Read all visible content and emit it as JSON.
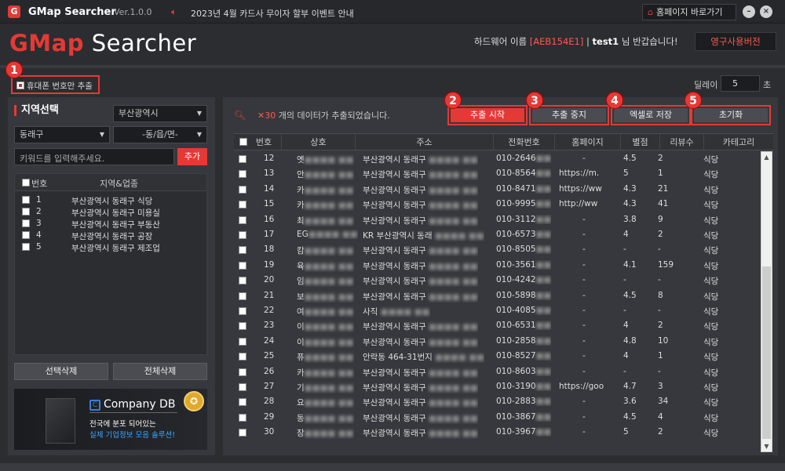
{
  "titlebar": {
    "logo": "G",
    "app_name": "GMap Searcher",
    "version": "Ver.1.0.0",
    "notice": "2023년 4월 카드사 무이자 할부 이벤트 안내",
    "home_button": "홈페이지 바로가기",
    "minimize": "–",
    "close": "×"
  },
  "header": {
    "brand_prefix": "GMap",
    "brand_suffix": " Searcher",
    "hw_prefix": "하드웨어 이름 ",
    "hw_id": "[AEB154E1]",
    "hw_sep": " | ",
    "user": "test1",
    "greeting": " 님 반갑습니다!",
    "perm_button": "영구사용버전"
  },
  "options": {
    "mobile_only": "휴대폰 번호만 추출",
    "delay_label": "딜레이 :",
    "delay_value": "5",
    "delay_unit": "초"
  },
  "badges": [
    "1",
    "2",
    "3",
    "4",
    "5"
  ],
  "region": {
    "title": "지역선택",
    "city": "부산광역시",
    "district": "동래구",
    "dong": "-동/읍/면-",
    "keyword_placeholder": "키워드를 입력해주세요.",
    "add": "추가",
    "col_no": "번호",
    "col_region": "지역&업종",
    "items": [
      {
        "no": "1",
        "label": "부산광역시 동래구 식당"
      },
      {
        "no": "2",
        "label": "부산광역시 동래구 미용실"
      },
      {
        "no": "3",
        "label": "부산광역시 동래구 부동산"
      },
      {
        "no": "4",
        "label": "부산광역시 동래구 공장"
      },
      {
        "no": "5",
        "label": "부산광역시 동래구 제조업"
      }
    ],
    "delete_selected": "선택삭제",
    "delete_all": "전체삭제"
  },
  "ad": {
    "brand": "Company DB",
    "line1": "전국에 분포 되어있는",
    "line2": "실제 기업정보 모음 솔루션!"
  },
  "results": {
    "count_prefix": "✕30",
    "count_text": " 개의 데이터가 추출되었습니다.",
    "buttons": {
      "start": "추출 시작",
      "stop": "추출 중지",
      "excel": "엑셀로 저장",
      "reset": "초기화"
    },
    "columns": [
      "번호",
      "상호",
      "주소",
      "전화번호",
      "홈페이지",
      "별점",
      "리뷰수",
      "카테고리"
    ],
    "rows": [
      {
        "no": "12",
        "name": "옛",
        "addr": "부산광역시 동래구",
        "phone": "010-2646",
        "home": "-",
        "star": "4.5",
        "rev": "2",
        "cat": "식당"
      },
      {
        "no": "13",
        "name": "안",
        "addr": "부산광역시 동래구",
        "phone": "010-8564",
        "home": "https://m.",
        "star": "5",
        "rev": "1",
        "cat": "식당"
      },
      {
        "no": "14",
        "name": "카",
        "addr": "부산광역시 동래구",
        "phone": "010-8471",
        "home": "https://ww",
        "star": "4.3",
        "rev": "21",
        "cat": "식당"
      },
      {
        "no": "15",
        "name": "카",
        "addr": "부산광역시 동래구",
        "phone": "010-9995",
        "home": "http://ww",
        "star": "4.3",
        "rev": "41",
        "cat": "식당"
      },
      {
        "no": "16",
        "name": "최",
        "addr": "부산광역시 동래구",
        "phone": "010-3112",
        "home": "-",
        "star": "3.8",
        "rev": "9",
        "cat": "식당"
      },
      {
        "no": "17",
        "name": "EG",
        "addr": "KR 부산광역시 동래",
        "phone": "010-6573",
        "home": "-",
        "star": "4",
        "rev": "2",
        "cat": "식당"
      },
      {
        "no": "18",
        "name": "캄",
        "addr": "부산광역시 동래구",
        "phone": "010-8505",
        "home": "-",
        "star": "-",
        "rev": "-",
        "cat": "식당"
      },
      {
        "no": "19",
        "name": "육",
        "addr": "부산광역시 동래구",
        "phone": "010-3561",
        "home": "-",
        "star": "4.1",
        "rev": "159",
        "cat": "식당"
      },
      {
        "no": "20",
        "name": "임",
        "addr": "부산광역시 동래구",
        "phone": "010-4242",
        "home": "-",
        "star": "-",
        "rev": "-",
        "cat": "식당"
      },
      {
        "no": "21",
        "name": "보",
        "addr": "부산광역시 동래구",
        "phone": "010-5898",
        "home": "-",
        "star": "4.5",
        "rev": "8",
        "cat": "식당"
      },
      {
        "no": "22",
        "name": "여",
        "addr": "사직",
        "phone": "010-4085",
        "home": "-",
        "star": "-",
        "rev": "-",
        "cat": "식당"
      },
      {
        "no": "23",
        "name": "이",
        "addr": "부산광역시 동래구",
        "phone": "010-6531",
        "home": "-",
        "star": "4",
        "rev": "2",
        "cat": "식당"
      },
      {
        "no": "24",
        "name": "이",
        "addr": "부산광역시 동래구",
        "phone": "010-2858",
        "home": "-",
        "star": "4.8",
        "rev": "10",
        "cat": "식당"
      },
      {
        "no": "25",
        "name": "퓨",
        "addr": "안락동 464-31번지",
        "phone": "010-8527",
        "home": "-",
        "star": "4",
        "rev": "1",
        "cat": "식당"
      },
      {
        "no": "26",
        "name": "카",
        "addr": "부산광역시 동래구",
        "phone": "010-8603",
        "home": "-",
        "star": "-",
        "rev": "-",
        "cat": "식당"
      },
      {
        "no": "27",
        "name": "기",
        "addr": "부산광역시 동래구",
        "phone": "010-3190",
        "home": "https://goo",
        "star": "4.7",
        "rev": "3",
        "cat": "식당"
      },
      {
        "no": "28",
        "name": "요",
        "addr": "부산광역시 동래구",
        "phone": "010-2883",
        "home": "-",
        "star": "3.6",
        "rev": "34",
        "cat": "식당"
      },
      {
        "no": "29",
        "name": "동",
        "addr": "부산광역시 동래구",
        "phone": "010-3867",
        "home": "-",
        "star": "4.5",
        "rev": "4",
        "cat": "식당"
      },
      {
        "no": "30",
        "name": "장",
        "addr": "부산광역시 동래구",
        "phone": "010-3967",
        "home": "-",
        "star": "5",
        "rev": "2",
        "cat": "식당"
      }
    ]
  }
}
